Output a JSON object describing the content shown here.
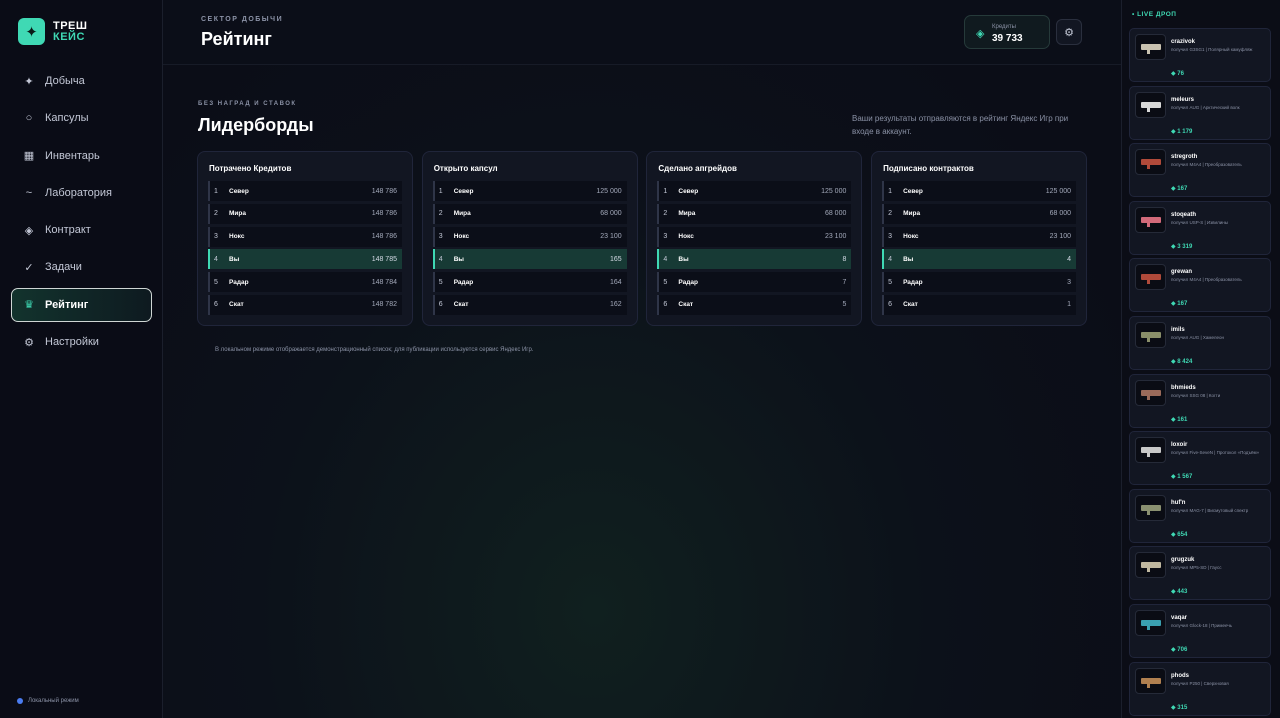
{
  "brand": {
    "line1": "ТРЕШ",
    "line2": "КЕЙС",
    "logo_icon": "sparkle-icon"
  },
  "nav": [
    {
      "label": "Добыча",
      "icon": "sparkle-icon",
      "glyph": "✦",
      "active": false
    },
    {
      "label": "Капсулы",
      "icon": "ring-icon",
      "glyph": "○",
      "active": false
    },
    {
      "label": "Инвентарь",
      "icon": "grid-icon",
      "glyph": "▦",
      "active": false
    },
    {
      "label": "Лаборатория",
      "icon": "tilde-icon",
      "glyph": "~",
      "active": false
    },
    {
      "label": "Контракт",
      "icon": "diamond-icon",
      "glyph": "◈",
      "active": false
    },
    {
      "label": "Задачи",
      "icon": "check-icon",
      "glyph": "✓",
      "active": false
    },
    {
      "label": "Рейтинг",
      "icon": "crown-icon",
      "glyph": "♛",
      "active": true
    },
    {
      "label": "Настройки",
      "icon": "gear-icon",
      "glyph": "⚙",
      "active": false
    }
  ],
  "status": {
    "local_mode": "Локальный режим"
  },
  "header": {
    "sector": "СЕКТОР ДОБЫЧИ",
    "title": "Рейтинг",
    "credits_label": "Кредиты",
    "credits_value": "39 733",
    "settings_icon": "gear-icon"
  },
  "section": {
    "overline": "БЕЗ НАГРАД И СТАВОК",
    "title": "Лидерборды",
    "notice": "Ваши результаты отправляются в рейтинг Яндекс Игр при входе в аккаунт.",
    "footnote": "В локальном режиме отображается демонстрационный список; для публикации используется сервис Яндекс Игр."
  },
  "boards": [
    {
      "title": "Потрачено Кредитов",
      "rows": [
        {
          "rank": "1",
          "name": "Север",
          "value": "148 786"
        },
        {
          "rank": "2",
          "name": "Мира",
          "value": "148 786"
        },
        {
          "rank": "3",
          "name": "Нокс",
          "value": "148 786"
        },
        {
          "rank": "4",
          "name": "Вы",
          "value": "148 785",
          "me": true
        },
        {
          "rank": "5",
          "name": "Радар",
          "value": "148 784"
        },
        {
          "rank": "6",
          "name": "Скат",
          "value": "148 782"
        }
      ]
    },
    {
      "title": "Открыто капсул",
      "rows": [
        {
          "rank": "1",
          "name": "Север",
          "value": "125 000"
        },
        {
          "rank": "2",
          "name": "Мира",
          "value": "68 000"
        },
        {
          "rank": "3",
          "name": "Нокс",
          "value": "23 100"
        },
        {
          "rank": "4",
          "name": "Вы",
          "value": "165",
          "me": true
        },
        {
          "rank": "5",
          "name": "Радар",
          "value": "164"
        },
        {
          "rank": "6",
          "name": "Скат",
          "value": "162"
        }
      ]
    },
    {
      "title": "Сделано апгрейдов",
      "rows": [
        {
          "rank": "1",
          "name": "Север",
          "value": "125 000"
        },
        {
          "rank": "2",
          "name": "Мира",
          "value": "68 000"
        },
        {
          "rank": "3",
          "name": "Нокс",
          "value": "23 100"
        },
        {
          "rank": "4",
          "name": "Вы",
          "value": "8",
          "me": true
        },
        {
          "rank": "5",
          "name": "Радар",
          "value": "7"
        },
        {
          "rank": "6",
          "name": "Скат",
          "value": "5"
        }
      ]
    },
    {
      "title": "Подписано контрактов",
      "rows": [
        {
          "rank": "1",
          "name": "Север",
          "value": "125 000"
        },
        {
          "rank": "2",
          "name": "Мира",
          "value": "68 000"
        },
        {
          "rank": "3",
          "name": "Нокс",
          "value": "23 100"
        },
        {
          "rank": "4",
          "name": "Вы",
          "value": "4",
          "me": true
        },
        {
          "rank": "5",
          "name": "Радар",
          "value": "3"
        },
        {
          "rank": "6",
          "name": "Скат",
          "value": "1"
        }
      ]
    }
  ],
  "live": {
    "header": "• LIVE ДРОП",
    "drops": [
      {
        "user": "crazivok",
        "item": "получил G3SG1 | Полярный камуфляж",
        "value": "◆ 76",
        "color": "#c9c2b0"
      },
      {
        "user": "meleurs",
        "item": "получил AUG | Арктический волк",
        "value": "◆ 1 179",
        "color": "#d8d8d8"
      },
      {
        "user": "stregroth",
        "item": "получил M4A4 | Преобразователь",
        "value": "◆ 167",
        "color": "#b04a3a"
      },
      {
        "user": "stoqeath",
        "item": "получил USP-S | Извилины",
        "value": "◆ 3 319",
        "color": "#d26a7a"
      },
      {
        "user": "grewan",
        "item": "получил M4A4 | Преобразователь",
        "value": "◆ 167",
        "color": "#b04a3a"
      },
      {
        "user": "imils",
        "item": "получил AUG | Хамелеон",
        "value": "◆ 8 424",
        "color": "#8a8f6a"
      },
      {
        "user": "bhmieds",
        "item": "получил SSG 08 | Когти",
        "value": "◆ 161",
        "color": "#9a6a5a"
      },
      {
        "user": "loxoir",
        "item": "получил Five-SeveN | Протокол «Подъём»",
        "value": "◆ 1 567",
        "color": "#c8c8c8"
      },
      {
        "user": "huf'n",
        "item": "получил MAG-7 | Висмутовый спектр",
        "value": "◆ 654",
        "color": "#8a9070"
      },
      {
        "user": "grugzuk",
        "item": "получил MP5-SD | Гаусс",
        "value": "◆ 443",
        "color": "#c0b8a0"
      },
      {
        "user": "vaqar",
        "item": "получил Glock-18 | Примеечь",
        "value": "◆ 706",
        "color": "#3aa0b0"
      },
      {
        "user": "phods",
        "item": "получил P250 | Сверхновая",
        "value": "◆ 315",
        "color": "#b08050"
      }
    ]
  }
}
